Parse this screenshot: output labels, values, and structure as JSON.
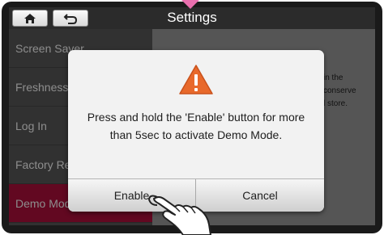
{
  "header": {
    "title": "Settings"
  },
  "menu": {
    "items": [
      {
        "label": "Screen Saver"
      },
      {
        "label": "Freshness"
      },
      {
        "label": "Log In"
      },
      {
        "label": "Factory Reset"
      },
      {
        "label": "Demo Mode"
      }
    ],
    "active_index": 4
  },
  "background_text": "in the\nconserve\nl store.",
  "dialog": {
    "icon": "warning-icon",
    "message": "Press and hold the 'Enable' button for more than 5sec to activate Demo Mode.",
    "enable_label": "Enable",
    "cancel_label": "Cancel"
  },
  "colors": {
    "accent_pointer": "#ea6fae",
    "active_menu": "#b2103c",
    "warning": "#e8692b"
  }
}
